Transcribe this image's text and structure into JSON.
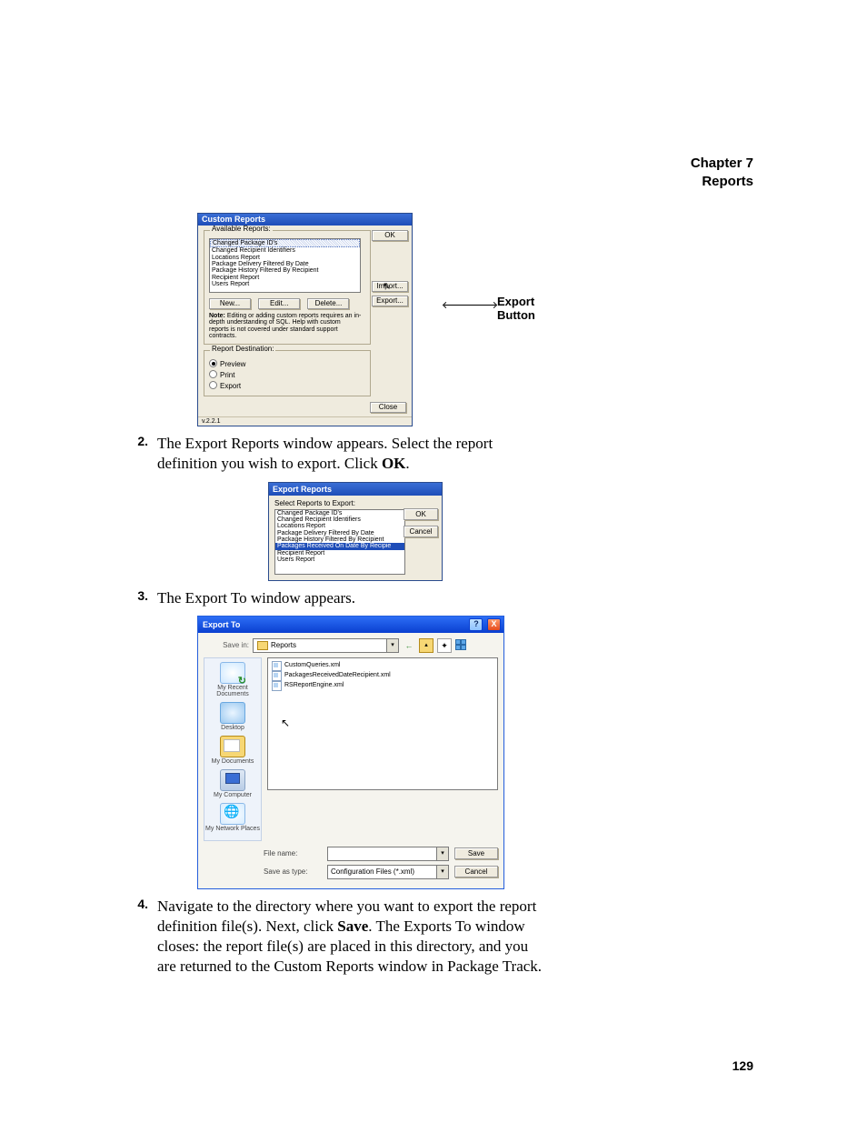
{
  "header": {
    "chapter": "Chapter 7",
    "section": "Reports"
  },
  "pageNumber": "129",
  "callout": "Export Button",
  "step2": {
    "num": "2.",
    "text_a": "The Export Reports window appears. Select the report definition you wish to export. Click ",
    "ok": "OK",
    "text_b": "."
  },
  "step3": {
    "num": "3.",
    "text": "The Export To window appears."
  },
  "step4": {
    "num": "4.",
    "text_a": "Navigate to the directory where you want to export the report definition file(s). Next, click ",
    "save": "Save",
    "text_b": ". The Exports To window closes: the report file(s) are placed in this directory, and you are returned to the Custom Reports window in Package Track."
  },
  "customReports": {
    "title": "Custom Reports",
    "group_available": "Available Reports:",
    "reports": [
      "Changed Package ID's",
      "Changed Recipient Identifiers",
      "Locations Report",
      "Package Delivery Filtered By Date",
      "Package History Filtered By Recipient",
      "Recipient Report",
      "Users Report"
    ],
    "btn_new": "New...",
    "btn_edit": "Edit...",
    "btn_delete": "Delete...",
    "btn_ok": "OK",
    "btn_import": "Import...",
    "btn_export": "Export...",
    "note_label": "Note:",
    "note_text": " Editing or adding custom reports requires an in-depth understanding of SQL. Help with custom reports is not covered under standard support contracts.",
    "group_dest": "Report Destination:",
    "radio_preview": "Preview",
    "radio_print": "Print",
    "radio_export": "Export",
    "btn_close": "Close",
    "version": "v.2.2.1"
  },
  "exportReports": {
    "title": "Export Reports",
    "label": "Select Reports to Export:",
    "reports": [
      "Changed Package ID's",
      "Changed Recipient Identifiers",
      "Locations Report",
      "Package Delivery Filtered By Date",
      "Package History Filtered By Recipient",
      "Packages Received On Date By Recipie",
      "Recipient Report",
      "Users Report"
    ],
    "btn_ok": "OK",
    "btn_cancel": "Cancel"
  },
  "exportTo": {
    "title": "Export To",
    "help_btn": "?",
    "close_btn": "X",
    "savein_label": "Save in:",
    "savein_value": "Reports",
    "files": [
      "CustomQueries.xml",
      "PackagesReceivedDateRecipient.xml",
      "RSReportEngine.xml"
    ],
    "places": {
      "recent": "My Recent Documents",
      "desktop": "Desktop",
      "docs": "My Documents",
      "computer": "My Computer",
      "network": "My Network Places"
    },
    "filename_label": "File name:",
    "filename_value": "",
    "saveas_label": "Save as type:",
    "saveas_value": "Configuration Files (*.xml)",
    "btn_save": "Save",
    "btn_cancel": "Cancel"
  }
}
